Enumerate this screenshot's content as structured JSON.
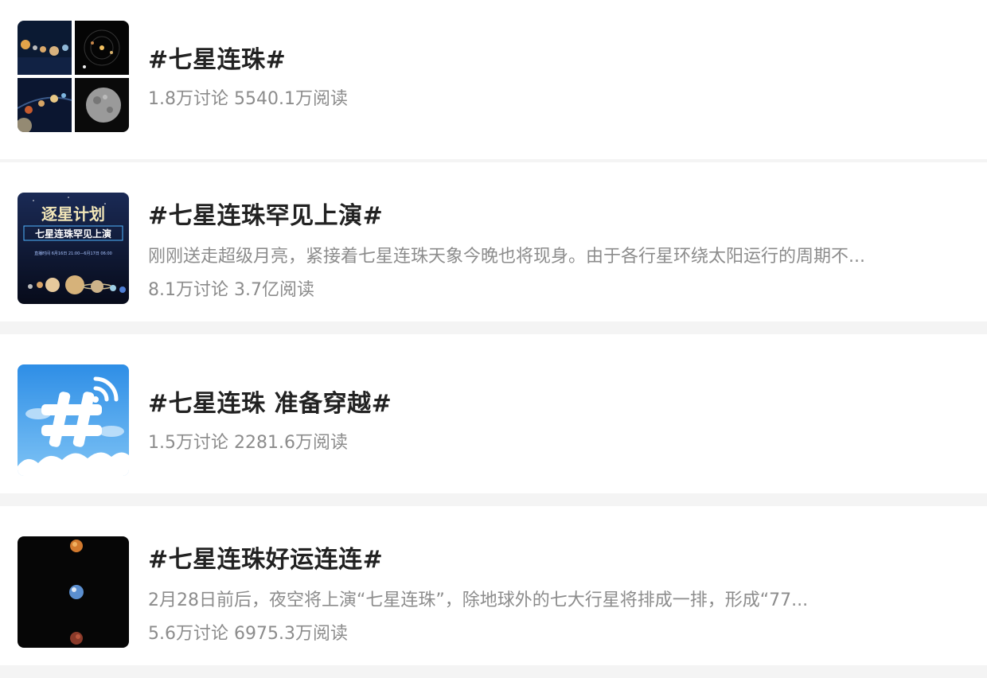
{
  "topics": [
    {
      "title": "#七星连珠#",
      "stats": "1.8万讨论 5540.1万阅读",
      "thumbnail": "solar-system-collage"
    },
    {
      "title": "#七星连珠罕见上演#",
      "description": "刚刚送走超级月亮，紧接着七星连珠天象今晚也将现身。由于各行星环绕太阳运行的周期不...",
      "stats": "8.1万讨论 3.7亿阅读",
      "thumbnail": "poster",
      "poster_heading": "逐星计划",
      "poster_subheading": "七星连珠罕见上演",
      "poster_time": "直播时间 6月16日 21:00—6月17日 06:00"
    },
    {
      "title": "#七星连珠 准备穿越#",
      "stats": "1.5万讨论 2281.6万阅读",
      "thumbnail": "hashtag-icon"
    },
    {
      "title": "#七星连珠好运连连#",
      "description": "2月28日前后，夜空将上演“七星连珠”，除地球外的七大行星将排成一排，形成“77...",
      "stats": "5.6万讨论 6975.3万阅读",
      "thumbnail": "planets-vertical"
    }
  ],
  "colors": {
    "title": "#222222",
    "meta": "#8c8c8c",
    "divider": "#f4f4f4",
    "hashtag_sky": "#4aa3ea"
  }
}
